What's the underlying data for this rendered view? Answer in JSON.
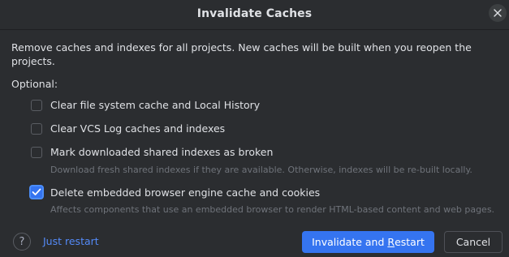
{
  "dialog": {
    "title": "Invalidate Caches",
    "close_icon": "close-icon",
    "description": "Remove caches and indexes for all projects. New caches will be built when you reopen the projects.",
    "optional_label": "Optional:"
  },
  "options": [
    {
      "label": "Clear file system cache and Local History",
      "checked": false,
      "hint": ""
    },
    {
      "label": "Clear VCS Log caches and indexes",
      "checked": false,
      "hint": ""
    },
    {
      "label": "Mark downloaded shared indexes as broken",
      "checked": false,
      "hint": "Download fresh shared indexes if they are available. Otherwise, indexes will be re-built locally."
    },
    {
      "label": "Delete embedded browser engine cache and cookies",
      "checked": true,
      "hint": "Affects components that use an embedded browser to render HTML-based content and web pages."
    }
  ],
  "footer": {
    "help_label": "?",
    "just_restart_label": "Just restart",
    "primary_label_pre": "Invalidate and ",
    "primary_label_mnemonic": "R",
    "primary_label_post": "estart",
    "cancel_label": "Cancel"
  },
  "colors": {
    "background": "#2b2d30",
    "accent": "#3574f0",
    "link": "#548af7",
    "hint": "#6f737a"
  }
}
